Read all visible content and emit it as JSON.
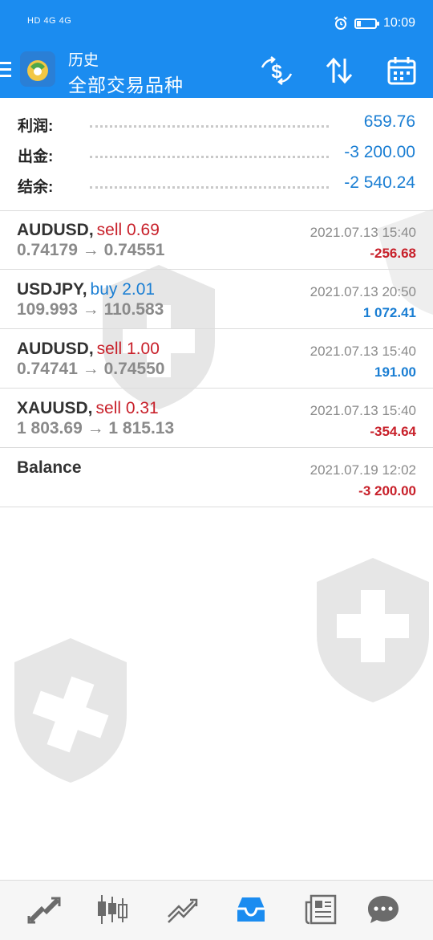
{
  "status_bar": {
    "network_label": "HD 4G 4G",
    "time": "10:09"
  },
  "header": {
    "title_small": "历史",
    "title_big": "全部交易品种",
    "menu_icon": "menu-icon",
    "logo_icon": "metatrader-logo-icon",
    "actions": [
      "currency-exchange-icon",
      "sort-icon",
      "calendar-icon"
    ]
  },
  "summary": [
    {
      "label": "利润:",
      "value": "659.76"
    },
    {
      "label": "出金:",
      "value": "-3 200.00"
    },
    {
      "label": "结余:",
      "value": "-2 540.24"
    }
  ],
  "trades": [
    {
      "symbol": "AUDUSD,",
      "side": "sell 0.69",
      "side_type": "sell",
      "prices": "0.74179 → 0.74551",
      "time": "2021.07.13 15:40",
      "profit": "-256.68",
      "profit_type": "neg"
    },
    {
      "symbol": "USDJPY,",
      "side": "buy 2.01",
      "side_type": "buy",
      "prices": "109.993 → 110.583",
      "time": "2021.07.13 20:50",
      "profit": "1 072.41",
      "profit_type": "pos"
    },
    {
      "symbol": "AUDUSD,",
      "side": "sell 1.00",
      "side_type": "sell",
      "prices": "0.74741 → 0.74550",
      "time": "2021.07.13 15:40",
      "profit": "191.00",
      "profit_type": "pos"
    },
    {
      "symbol": "XAUUSD,",
      "side": "sell 0.31",
      "side_type": "sell",
      "prices": "1 803.69 → 1 815.13",
      "time": "2021.07.13 15:40",
      "profit": "-354.64",
      "profit_type": "neg"
    },
    {
      "symbol": "Balance",
      "side": "",
      "side_type": "",
      "prices": "",
      "time": "2021.07.19 12:02",
      "profit": "-3 200.00",
      "profit_type": "neg"
    }
  ],
  "bottom_nav": {
    "items": [
      "quotes-icon",
      "chart-icon",
      "trade-icon",
      "history-icon",
      "news-icon",
      "chat-icon"
    ],
    "active": "history-icon",
    "active_color": "#1b8cf0",
    "inactive_color": "#6b6b6b"
  },
  "colors": {
    "header_bg": "#1b8cf0",
    "positive": "#1a7ed3",
    "negative": "#c8202a"
  }
}
